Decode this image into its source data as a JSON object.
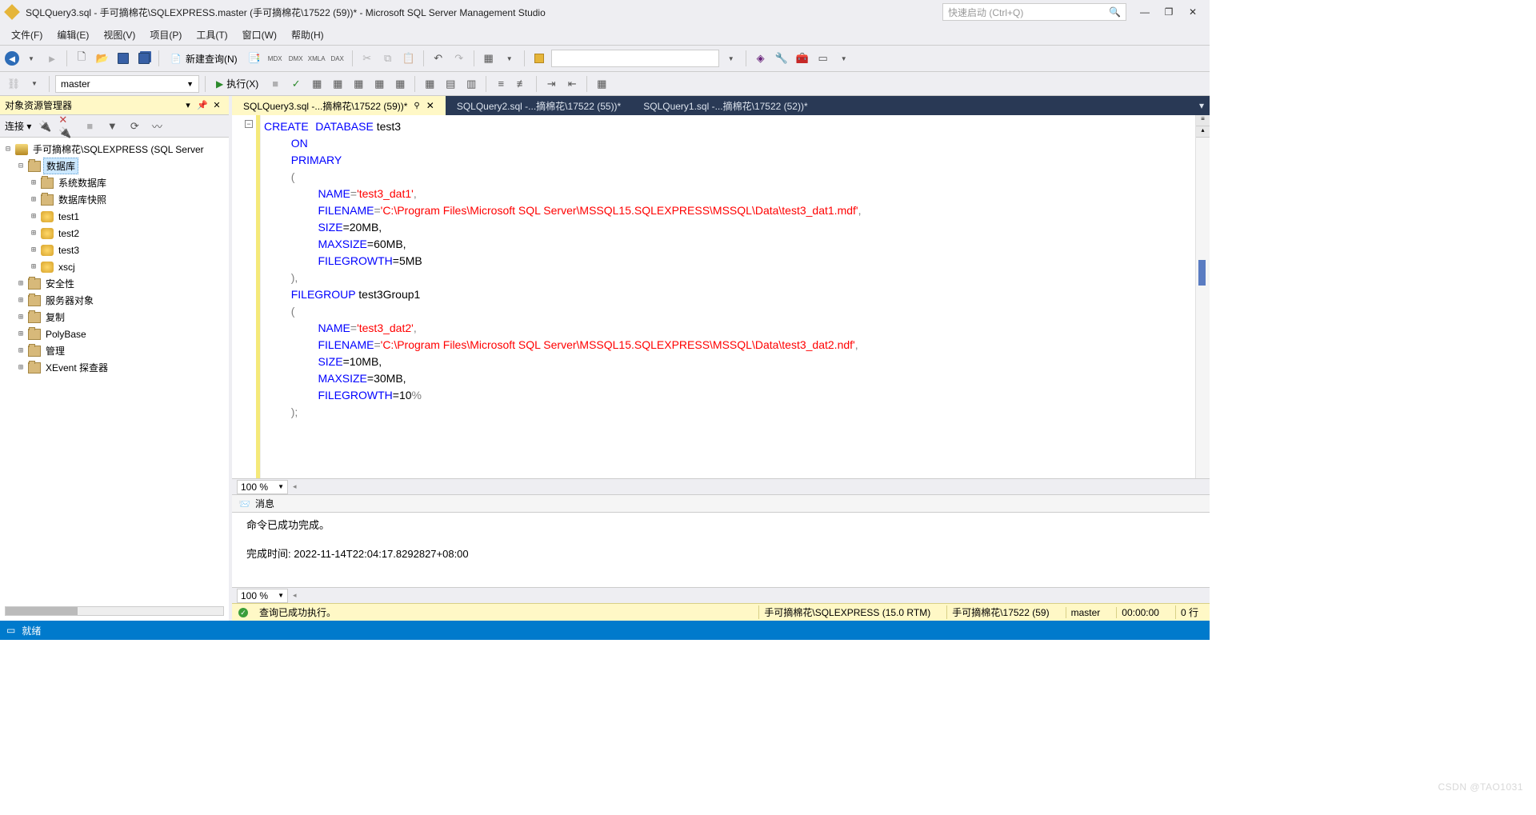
{
  "title_bar": {
    "title": "SQLQuery3.sql - 手可摘棉花\\SQLEXPRESS.master (手可摘棉花\\17522 (59))* - Microsoft SQL Server Management Studio",
    "quick_launch_placeholder": "快速启动 (Ctrl+Q)"
  },
  "menu": {
    "file": "文件(F)",
    "edit": "编辑(E)",
    "view": "视图(V)",
    "project": "项目(P)",
    "tools": "工具(T)",
    "window": "窗口(W)",
    "help": "帮助(H)"
  },
  "toolbar": {
    "new_query": "新建查询(N)",
    "db_selected": "master",
    "execute": "执行(X)"
  },
  "object_explorer": {
    "title": "对象资源管理器",
    "connect_label": "连接 ▾",
    "server": "手可摘棉花\\SQLEXPRESS (SQL Server",
    "databases": "数据库",
    "system_databases": "系统数据库",
    "db_snapshots": "数据库快照",
    "db_test1": "test1",
    "db_test2": "test2",
    "db_test3": "test3",
    "db_xscj": "xscj",
    "security": "安全性",
    "server_objects": "服务器对象",
    "replication": "复制",
    "polybase": "PolyBase",
    "management": "管理",
    "xevent": "XEvent 探查器"
  },
  "tabs": {
    "tab1": "SQLQuery3.sql -...摘棉花\\17522 (59))*",
    "tab2": "SQLQuery2.sql -...摘棉花\\17522 (55))*",
    "tab3": "SQLQuery1.sql -...摘棉花\\17522 (52))*"
  },
  "code": {
    "l1_kw1": "CREATE",
    "l1_kw2": "DATABASE",
    "l1_id": " test3",
    "l2_kw": "ON",
    "l3_kw": "PRIMARY",
    "l4": "(",
    "l5_kw": "NAME",
    "l5_eq": "=",
    "l5_str": "'test3_dat1'",
    "l5_comma": ",",
    "l6_kw": "FILENAME",
    "l6_eq": "=",
    "l6_str": "'C:\\Program Files\\Microsoft SQL Server\\MSSQL15.SQLEXPRESS\\MSSQL\\Data\\test3_dat1.mdf'",
    "l6_comma": ",",
    "l7_kw": "SIZE",
    "l7_rest": "=20MB,",
    "l8_kw": "MAXSIZE",
    "l8_rest": "=60MB,",
    "l9_kw": "FILEGROWTH",
    "l9_rest": "=5MB",
    "l10": "),",
    "l11_kw": "FILEGROUP",
    "l11_id": " test3Group1",
    "l12": "(",
    "l13_kw": "NAME",
    "l13_eq": "=",
    "l13_str": "'test3_dat2'",
    "l13_comma": ",",
    "l14_kw": "FILENAME",
    "l14_eq": "=",
    "l14_str": "'C:\\Program Files\\Microsoft SQL Server\\MSSQL15.SQLEXPRESS\\MSSQL\\Data\\test3_dat2.ndf'",
    "l14_comma": ",",
    "l15_kw": "SIZE",
    "l15_rest": "=10MB,",
    "l16_kw": "MAXSIZE",
    "l16_rest": "=30MB,",
    "l17_kw": "FILEGROWTH",
    "l17_rest": "=10",
    "l17_pct": "%",
    "l18": ");"
  },
  "zoom": {
    "value": "100 %"
  },
  "messages": {
    "tab_label": "消息",
    "line1": "命令已成功完成。",
    "line2": "完成时间: 2022-11-14T22:04:17.8292827+08:00"
  },
  "status": {
    "exec_label": "查询已成功执行。",
    "server": "手可摘棉花\\SQLEXPRESS (15.0 RTM)",
    "user": "手可摘棉花\\17522 (59)",
    "db": "master",
    "time": "00:00:00",
    "rows": "0 行"
  },
  "bottom": {
    "ready": "就绪"
  },
  "watermark": "CSDN @TAO1031"
}
